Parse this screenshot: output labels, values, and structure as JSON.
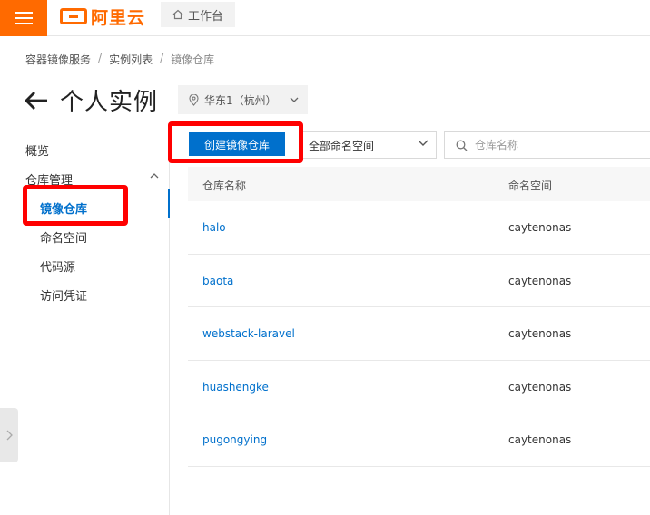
{
  "topbar": {
    "logo_text": "阿里云",
    "workbench_label": "工作台"
  },
  "breadcrumb": [
    "容器镜像服务",
    "实例列表",
    "镜像仓库"
  ],
  "page": {
    "title": "个人实例",
    "region": "华东1（杭州）"
  },
  "sidebar": {
    "overview": "概览",
    "repo_mgmt": "仓库管理",
    "items": [
      "镜像仓库",
      "命名空间",
      "代码源",
      "访问凭证"
    ]
  },
  "toolbar": {
    "create_label": "创建镜像仓库",
    "namespace_select": "全部命名空间",
    "search_placeholder": "仓库名称"
  },
  "table": {
    "headers": [
      "仓库名称",
      "命名空间"
    ],
    "rows": [
      {
        "name": "halo",
        "namespace": "caytenonas"
      },
      {
        "name": "baota",
        "namespace": "caytenonas"
      },
      {
        "name": "webstack-laravel",
        "namespace": "caytenonas"
      },
      {
        "name": "huashengke",
        "namespace": "caytenonas"
      },
      {
        "name": "pugongying",
        "namespace": "caytenonas"
      }
    ]
  },
  "colors": {
    "brand": "#ff6a00",
    "primary": "#0070cc",
    "highlight": "#ff0000"
  }
}
